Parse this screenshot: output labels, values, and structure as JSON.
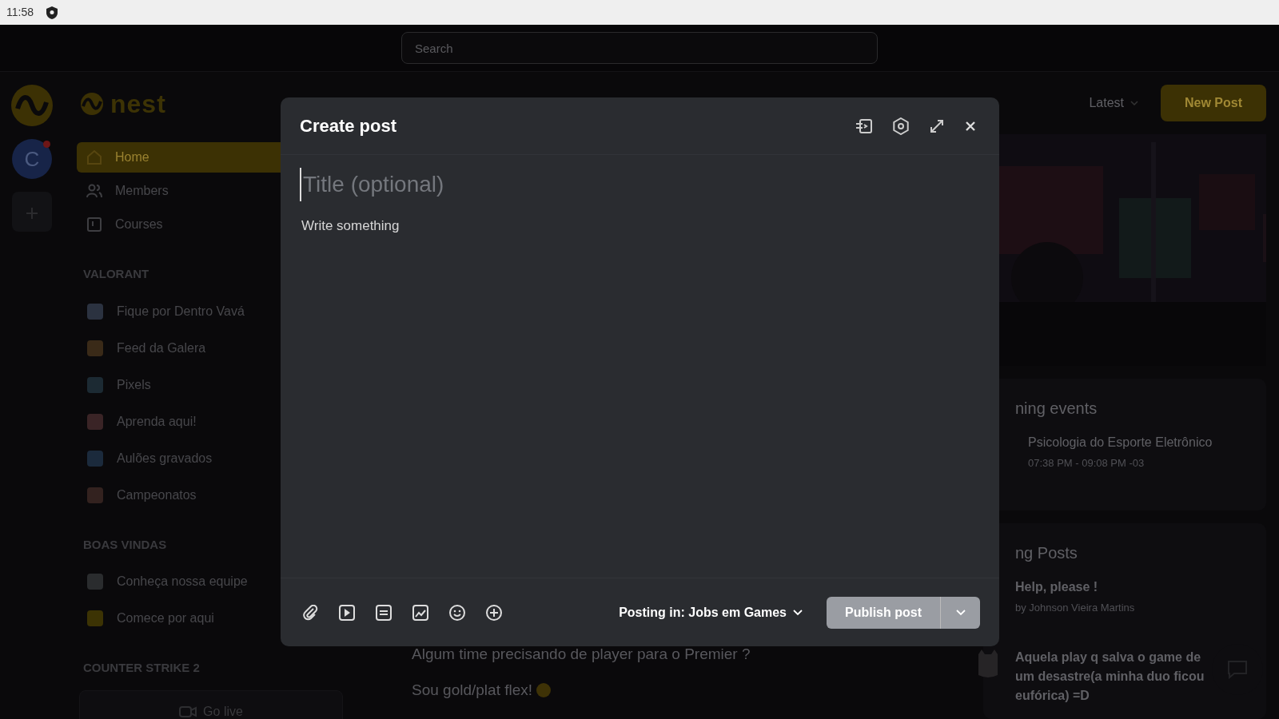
{
  "status_bar": {
    "time": "11:58"
  },
  "top_bar": {
    "search": {
      "placeholder": "Search"
    }
  },
  "rail": {
    "avatar_letter": "C",
    "notification": true
  },
  "brand": {
    "name": "nest"
  },
  "nav": [
    {
      "label": "Home",
      "selected": true
    },
    {
      "label": "Members",
      "selected": false
    },
    {
      "label": "Courses",
      "selected": false
    }
  ],
  "sections": [
    {
      "title": "VALORANT",
      "items": [
        "Fique por Dentro Vavá",
        "Feed da Galera",
        "Pixels",
        "Aprenda aqui!",
        "Aulões gravados",
        "Campeonatos"
      ]
    },
    {
      "title": "BOAS VINDAS",
      "items": [
        "Conheça nossa equipe",
        "Comece por aqui"
      ]
    },
    {
      "title": "COUNTER STRIKE 2"
    }
  ],
  "go_live": "Go live",
  "feed": {
    "sort": "Latest",
    "new_post": "New Post",
    "post_lines": [
      "Algum time precisando de player para o Premier ?",
      "Sou gold/plat flex!"
    ]
  },
  "events": {
    "title": "ning events",
    "items": [
      {
        "name": "Psicologia do Esporte Eletrônico",
        "time": "07:38 PM - 09:08 PM -03"
      }
    ]
  },
  "trending": {
    "title": "ng Posts",
    "posts": [
      {
        "title": "Help, please !",
        "author": "by Johnson Vieira Martins"
      },
      {
        "title": "Aquela play q salva o game de um desastre(a minha duo ficou eufórica) =D"
      }
    ]
  },
  "modal": {
    "title": "Create post",
    "title_placeholder": "Title (optional)",
    "body_placeholder": "Write something",
    "posting_in_label": "Posting in:",
    "space": "Jobs em Games",
    "publish": "Publish post",
    "publish_disabled": true
  }
}
